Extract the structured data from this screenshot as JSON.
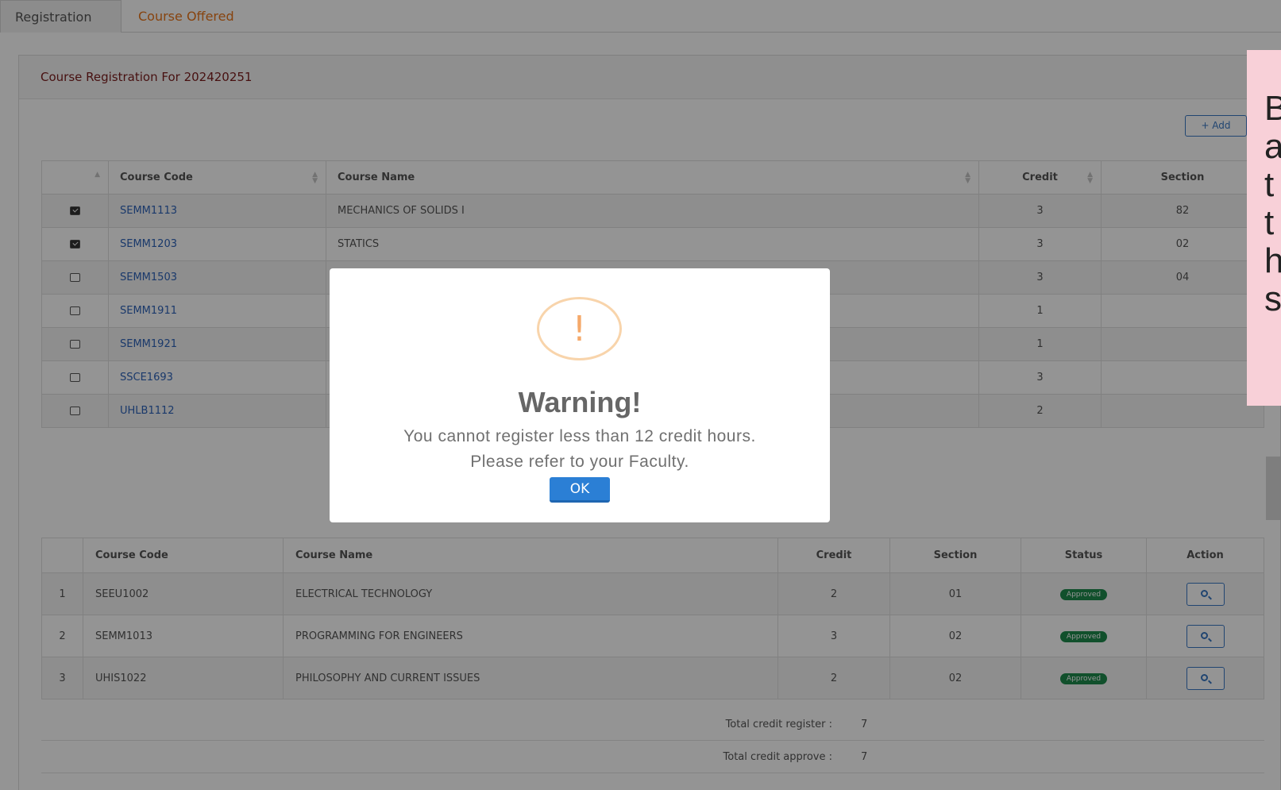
{
  "tabs": [
    {
      "label": "Registration"
    },
    {
      "label": "Course Offered"
    }
  ],
  "panel": {
    "title": "Course Registration For 202420251"
  },
  "add_button": {
    "label": "+ Add"
  },
  "offered_table": {
    "headers": {
      "code": "Course Code",
      "name": "Course Name",
      "credit": "Credit",
      "section": "Section"
    },
    "rows": [
      {
        "checked": true,
        "code": "SEMM1113",
        "name": "MECHANICS OF SOLIDS I",
        "credit": "3",
        "section": "82"
      },
      {
        "checked": true,
        "code": "SEMM1203",
        "name": "STATICS",
        "credit": "3",
        "section": "02"
      },
      {
        "checked": false,
        "code": "SEMM1503",
        "name": "",
        "credit": "3",
        "section": "04"
      },
      {
        "checked": false,
        "code": "SEMM1911",
        "name": "",
        "credit": "1",
        "section": ""
      },
      {
        "checked": false,
        "code": "SEMM1921",
        "name": "",
        "credit": "1",
        "section": ""
      },
      {
        "checked": false,
        "code": "SSCE1693",
        "name": "",
        "credit": "3",
        "section": ""
      },
      {
        "checked": false,
        "code": "UHLB1112",
        "name": "",
        "credit": "2",
        "section": ""
      }
    ]
  },
  "registered_table": {
    "headers": {
      "code": "Course Code",
      "name": "Course Name",
      "credit": "Credit",
      "section": "Section",
      "status": "Status",
      "action": "Action"
    },
    "rows": [
      {
        "no": "1",
        "code": "SEEU1002",
        "name": "ELECTRICAL TECHNOLOGY",
        "credit": "2",
        "section": "01",
        "status": "Approved"
      },
      {
        "no": "2",
        "code": "SEMM1013",
        "name": "PROGRAMMING FOR ENGINEERS",
        "credit": "3",
        "section": "02",
        "status": "Approved"
      },
      {
        "no": "3",
        "code": "UHIS1022",
        "name": "PHILOSOPHY AND CURRENT ISSUES",
        "credit": "2",
        "section": "02",
        "status": "Approved"
      }
    ]
  },
  "totals": {
    "register_label": "Total credit register :",
    "register_value": "7",
    "approve_label": "Total credit approve :",
    "approve_value": "7"
  },
  "modal": {
    "icon": "!",
    "title": "Warning!",
    "line1": "You cannot register less than 12 credit hours.",
    "line2": "Please refer to your Faculty.",
    "ok_label": "OK"
  },
  "note": {
    "text": "B\na\nt\nt\nh\ns"
  },
  "colors": {
    "link": "#2e63b8",
    "tab_inactive": "#e8751a",
    "approved": "#1e8a4d",
    "ok_button": "#2b7fd5",
    "note_bg": "#f8d0d8"
  }
}
